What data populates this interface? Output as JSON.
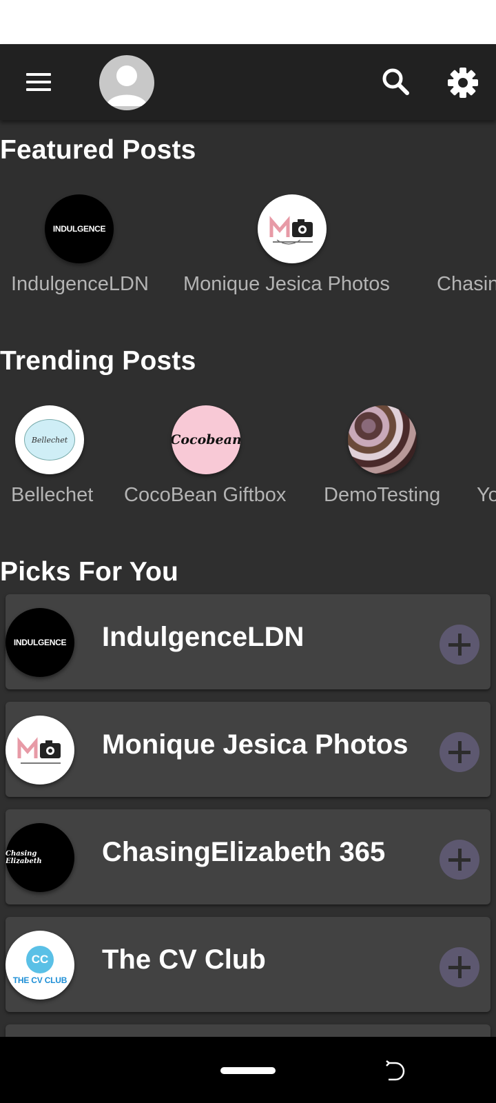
{
  "header": {
    "menu_icon": "hamburger-menu-icon",
    "avatar_icon": "user-avatar-icon",
    "search_icon": "search-icon",
    "settings_icon": "gear-icon"
  },
  "featured": {
    "title": "Featured Posts",
    "items": [
      {
        "label": "IndulgenceLDN",
        "logo_text": "INDULGENCE"
      },
      {
        "label": "Monique Jesica Photos"
      },
      {
        "label": "Chasin"
      }
    ]
  },
  "trending": {
    "title": "Trending Posts",
    "items": [
      {
        "label": "Bellechet",
        "logo_text": "Bellechet"
      },
      {
        "label": "CocoBean Giftbox",
        "logo_text": "Cocobean"
      },
      {
        "label": "DemoTesting"
      },
      {
        "label": "Yo"
      }
    ]
  },
  "picks": {
    "title": "Picks For You",
    "items": [
      {
        "name": "IndulgenceLDN",
        "logo_text": "INDULGENCE"
      },
      {
        "name": "Monique Jesica Photos"
      },
      {
        "name": "ChasingElizabeth 365",
        "logo_text": "Chasing Elizabeth"
      },
      {
        "name": "The CV Club",
        "logo_badge": "CC",
        "logo_text": "THE CV CLUB"
      }
    ]
  },
  "colors": {
    "app_bar": "#212121",
    "background": "#2f2f2f",
    "card": "#424242",
    "add_button": "#5d5870",
    "label_grey": "#b4b4b4"
  }
}
